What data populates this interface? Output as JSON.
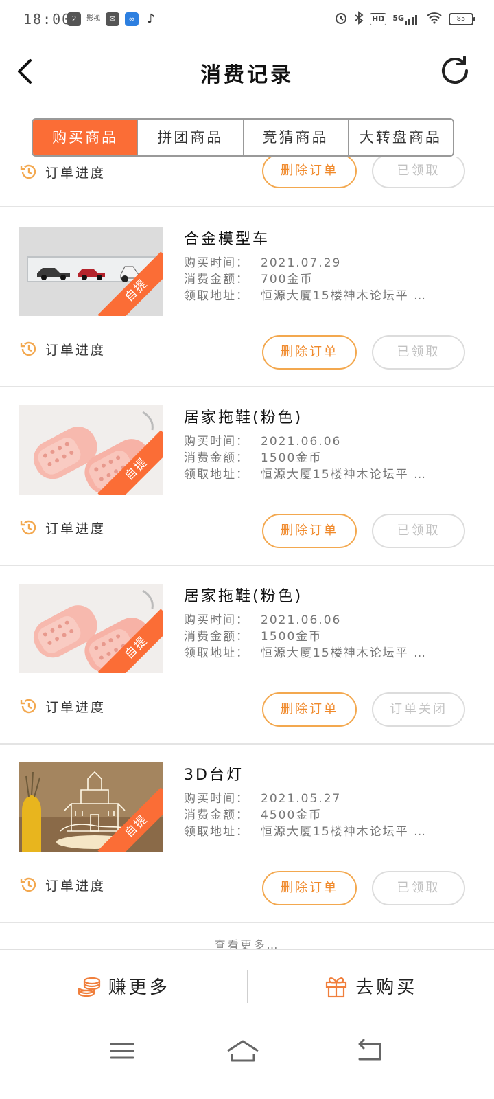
{
  "status_bar": {
    "time": "18:00",
    "app_icons": [
      "2",
      "影视",
      "✉",
      "∞",
      "♪"
    ],
    "hd_label": "HD",
    "network_label": "5G",
    "battery_label": "85"
  },
  "header": {
    "title": "消费记录"
  },
  "tabs": [
    {
      "label": "购买商品",
      "active": true
    },
    {
      "label": "拼团商品",
      "active": false
    },
    {
      "label": "竞猜商品",
      "active": false
    },
    {
      "label": "大转盘商品",
      "active": false
    }
  ],
  "labels": {
    "progress": "订单进度",
    "delete": "删除订单",
    "purchase_time": "购买时间：",
    "amount": "消费金额：",
    "address": "领取地址：",
    "pickup_badge": "自提"
  },
  "partial_order": {
    "status": "已领取"
  },
  "orders": [
    {
      "name": "合金模型车",
      "purchase_time": "2021.07.29",
      "amount": "700金币",
      "address": "恒源大厦15楼神木论坛平 …",
      "status": "已领取",
      "image": "model-cars"
    },
    {
      "name": "居家拖鞋(粉色)",
      "purchase_time": "2021.06.06",
      "amount": "1500金币",
      "address": "恒源大厦15楼神木论坛平 …",
      "status": "已领取",
      "image": "pink-slippers"
    },
    {
      "name": "居家拖鞋(粉色)",
      "purchase_time": "2021.06.06",
      "amount": "1500金币",
      "address": "恒源大厦15楼神木论坛平 …",
      "status": "订单关闭",
      "image": "pink-slippers"
    },
    {
      "name": "3D台灯",
      "purchase_time": "2021.05.27",
      "amount": "4500金币",
      "address": "恒源大厦15楼神木论坛平 …",
      "status": "已领取",
      "image": "castle-lamp"
    }
  ],
  "load_more": "查看更多…",
  "bottom_bar": {
    "earn_label": "赚更多",
    "buy_label": "去购买"
  },
  "colors": {
    "accent": "#fb6d36",
    "button_orange": "#f08a2c"
  }
}
